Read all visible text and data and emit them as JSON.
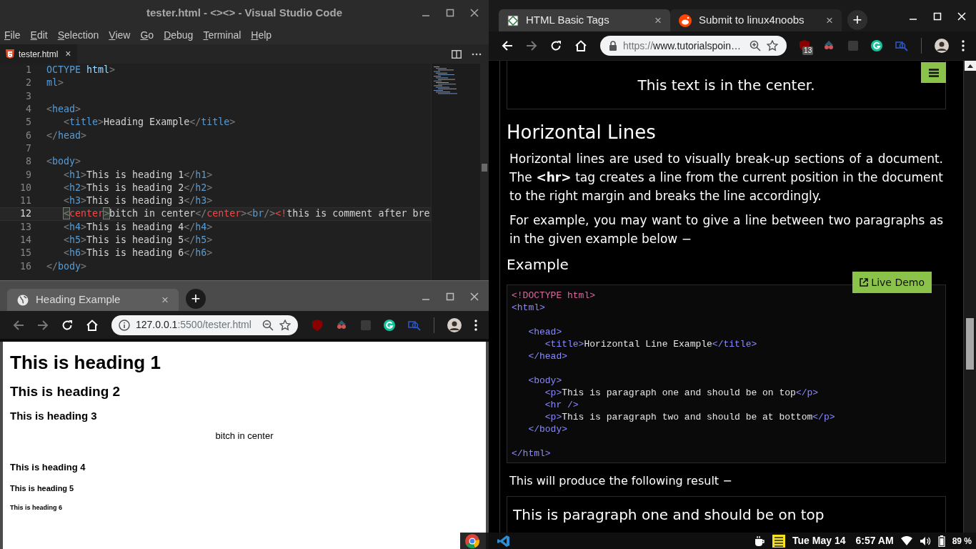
{
  "vscode": {
    "title": "tester.html - <><> - Visual Studio Code",
    "menu": [
      "File",
      "Edit",
      "Selection",
      "View",
      "Go",
      "Debug",
      "Terminal",
      "Help"
    ],
    "tab": {
      "label": "tester.html",
      "close": "×"
    },
    "lines": [
      {
        "number": "1",
        "current": false,
        "tokens": [
          {
            "kind": "tag",
            "text": "OCTYPE"
          },
          {
            "kind": "attr",
            "text": " html"
          },
          {
            "kind": "punct",
            "text": ">"
          }
        ]
      },
      {
        "number": "2",
        "current": false,
        "tokens": [
          {
            "kind": "tag",
            "text": "ml"
          },
          {
            "kind": "punct",
            "text": ">"
          }
        ]
      },
      {
        "number": "3",
        "current": false
      },
      {
        "number": "4",
        "current": false,
        "tokens": [
          {
            "kind": "punct",
            "text": "<"
          },
          {
            "kind": "tag",
            "text": "head"
          },
          {
            "kind": "punct",
            "text": ">"
          }
        ]
      },
      {
        "number": "5",
        "current": false,
        "tokens": [
          {
            "kind": "punct",
            "text": "   <"
          },
          {
            "kind": "tag",
            "text": "title"
          },
          {
            "kind": "punct",
            "text": ">"
          },
          {
            "kind": "text",
            "text": "Heading Example"
          },
          {
            "kind": "punct",
            "text": "</"
          },
          {
            "kind": "tag",
            "text": "title"
          },
          {
            "kind": "punct",
            "text": ">"
          }
        ]
      },
      {
        "number": "6",
        "current": false,
        "tokens": [
          {
            "kind": "punct",
            "text": "</"
          },
          {
            "kind": "tag",
            "text": "head"
          },
          {
            "kind": "punct",
            "text": ">"
          }
        ]
      },
      {
        "number": "7",
        "current": false
      },
      {
        "number": "8",
        "current": false,
        "tokens": [
          {
            "kind": "punct",
            "text": "<"
          },
          {
            "kind": "tag",
            "text": "body"
          },
          {
            "kind": "punct",
            "text": ">"
          }
        ]
      },
      {
        "number": "9",
        "current": false,
        "tokens": [
          {
            "kind": "punct",
            "text": "   <"
          },
          {
            "kind": "tag",
            "text": "h1"
          },
          {
            "kind": "punct",
            "text": ">"
          },
          {
            "kind": "text",
            "text": "This is heading 1"
          },
          {
            "kind": "punct",
            "text": "</"
          },
          {
            "kind": "tag",
            "text": "h1"
          },
          {
            "kind": "punct",
            "text": ">"
          }
        ]
      },
      {
        "number": "10",
        "current": false,
        "tokens": [
          {
            "kind": "punct",
            "text": "   <"
          },
          {
            "kind": "tag",
            "text": "h2"
          },
          {
            "kind": "punct",
            "text": ">"
          },
          {
            "kind": "text",
            "text": "This is heading 2"
          },
          {
            "kind": "punct",
            "text": "</"
          },
          {
            "kind": "tag",
            "text": "h2"
          },
          {
            "kind": "punct",
            "text": ">"
          }
        ]
      },
      {
        "number": "11",
        "current": false,
        "tokens": [
          {
            "kind": "punct",
            "text": "   <"
          },
          {
            "kind": "tag",
            "text": "h3"
          },
          {
            "kind": "punct",
            "text": ">"
          },
          {
            "kind": "text",
            "text": "This is heading 3"
          },
          {
            "kind": "punct",
            "text": "</"
          },
          {
            "kind": "tag",
            "text": "h3"
          },
          {
            "kind": "punct",
            "text": ">"
          }
        ]
      },
      {
        "number": "12",
        "current": true,
        "indented": true,
        "tokens": [
          {
            "kind": "match",
            "text": "<"
          },
          {
            "kind": "invalid",
            "text": "center"
          },
          {
            "kind": "match",
            "text": ">"
          },
          {
            "kind": "text",
            "text": "bitch in center"
          },
          {
            "kind": "punct",
            "text": "</"
          },
          {
            "kind": "invalid",
            "text": "center"
          },
          {
            "kind": "punct",
            "text": "><"
          },
          {
            "kind": "tag",
            "text": "br"
          },
          {
            "kind": "punct",
            "text": "/>"
          },
          {
            "kind": "invalid",
            "text": "<!"
          },
          {
            "kind": "text",
            "text": "this is comment after bre"
          }
        ]
      },
      {
        "number": "13",
        "current": false,
        "tokens": [
          {
            "kind": "punct",
            "text": "   <"
          },
          {
            "kind": "tag",
            "text": "h4"
          },
          {
            "kind": "punct",
            "text": ">"
          },
          {
            "kind": "text",
            "text": "This is heading 4"
          },
          {
            "kind": "punct",
            "text": "</"
          },
          {
            "kind": "tag",
            "text": "h4"
          },
          {
            "kind": "punct",
            "text": ">"
          }
        ]
      },
      {
        "number": "14",
        "current": false,
        "tokens": [
          {
            "kind": "punct",
            "text": "   <"
          },
          {
            "kind": "tag",
            "text": "h5"
          },
          {
            "kind": "punct",
            "text": ">"
          },
          {
            "kind": "text",
            "text": "This is heading 5"
          },
          {
            "kind": "punct",
            "text": "</"
          },
          {
            "kind": "tag",
            "text": "h5"
          },
          {
            "kind": "punct",
            "text": ">"
          }
        ]
      },
      {
        "number": "15",
        "current": false,
        "tokens": [
          {
            "kind": "punct",
            "text": "   <"
          },
          {
            "kind": "tag",
            "text": "h6"
          },
          {
            "kind": "punct",
            "text": ">"
          },
          {
            "kind": "text",
            "text": "This is heading 6"
          },
          {
            "kind": "punct",
            "text": "</"
          },
          {
            "kind": "tag",
            "text": "h6"
          },
          {
            "kind": "punct",
            "text": ">"
          }
        ]
      },
      {
        "number": "16",
        "current": false,
        "tokens": [
          {
            "kind": "punct",
            "text": "</"
          },
          {
            "kind": "tag",
            "text": "body"
          },
          {
            "kind": "punct",
            "text": ">"
          }
        ]
      }
    ]
  },
  "preview_browser": {
    "tabs": [
      {
        "title": "Heading Example",
        "close": "×",
        "selected": true
      }
    ],
    "new_tab": "+",
    "url_host": "127.0.0.1",
    "url_rest": ":5500/tester.html",
    "page": [
      {
        "kind": "h1",
        "text": "This is heading 1"
      },
      {
        "kind": "h2",
        "text": "This is heading 2"
      },
      {
        "kind": "h3",
        "text": "This is heading 3"
      },
      {
        "kind": "center",
        "text": "bitch in center"
      },
      {
        "kind": "h4",
        "text": "This is heading 4"
      },
      {
        "kind": "h5",
        "text": "This is heading 5"
      },
      {
        "kind": "h6",
        "text": "This is heading 6"
      }
    ]
  },
  "docs_browser": {
    "tabs": [
      {
        "title": "HTML Basic Tags",
        "close": "×",
        "selected": true
      },
      {
        "title": "Submit to linux4noobs",
        "close": "×",
        "selected": false
      }
    ],
    "new_tab": "+",
    "url_scheme": "https://",
    "url_rest": "www.tutorialspoin…",
    "extension_badge": "13",
    "page": {
      "centered_text": "This text is in the center.",
      "heading": "Horizontal Lines",
      "paragraphs": [
        "Horizontal lines are used to visually break-up sections of a document. The **<hr>** tag creates a line from the current position in the document to the right margin and breaks the line accordingly.",
        "For example, you may want to give a line between two paragraphs as in the given example below −"
      ],
      "example_heading": "Example",
      "live_demo": "Live Demo",
      "code_blocks": [
        [
          [
            {
              "kind": "doctype",
              "text": "<!DOCTYPE html>"
            }
          ],
          [
            {
              "kind": "tag",
              "text": "<html>"
            }
          ]
        ],
        [
          [
            {
              "kind": "tag",
              "text": "   <head>"
            }
          ],
          [
            {
              "kind": "tag",
              "text": "      <title>"
            },
            {
              "kind": "text",
              "text": "Horizontal Line Example"
            },
            {
              "kind": "tag",
              "text": "</title>"
            }
          ],
          [
            {
              "kind": "tag",
              "text": "   </head>"
            }
          ]
        ],
        [
          [
            {
              "kind": "tag",
              "text": "   <body>"
            }
          ],
          [
            {
              "kind": "tag",
              "text": "      <p>"
            },
            {
              "kind": "text",
              "text": "This is paragraph one and should be on top"
            },
            {
              "kind": "tag",
              "text": "</p>"
            }
          ],
          [
            {
              "kind": "tag",
              "text": "      <hr />"
            }
          ],
          [
            {
              "kind": "tag",
              "text": "      <p>"
            },
            {
              "kind": "text",
              "text": "This is paragraph two and should be at bottom"
            },
            {
              "kind": "tag",
              "text": "</p>"
            }
          ],
          [
            {
              "kind": "tag",
              "text": "   </body>"
            }
          ]
        ],
        [
          [
            {
              "kind": "tag",
              "text": "</html>"
            }
          ]
        ]
      ],
      "result_intro": "This will produce the following result −",
      "result_text": "This is paragraph one and should be on top"
    }
  },
  "taskbar": {
    "date": "Tue May 14",
    "time": "6:57 AM",
    "battery": "89 %"
  }
}
